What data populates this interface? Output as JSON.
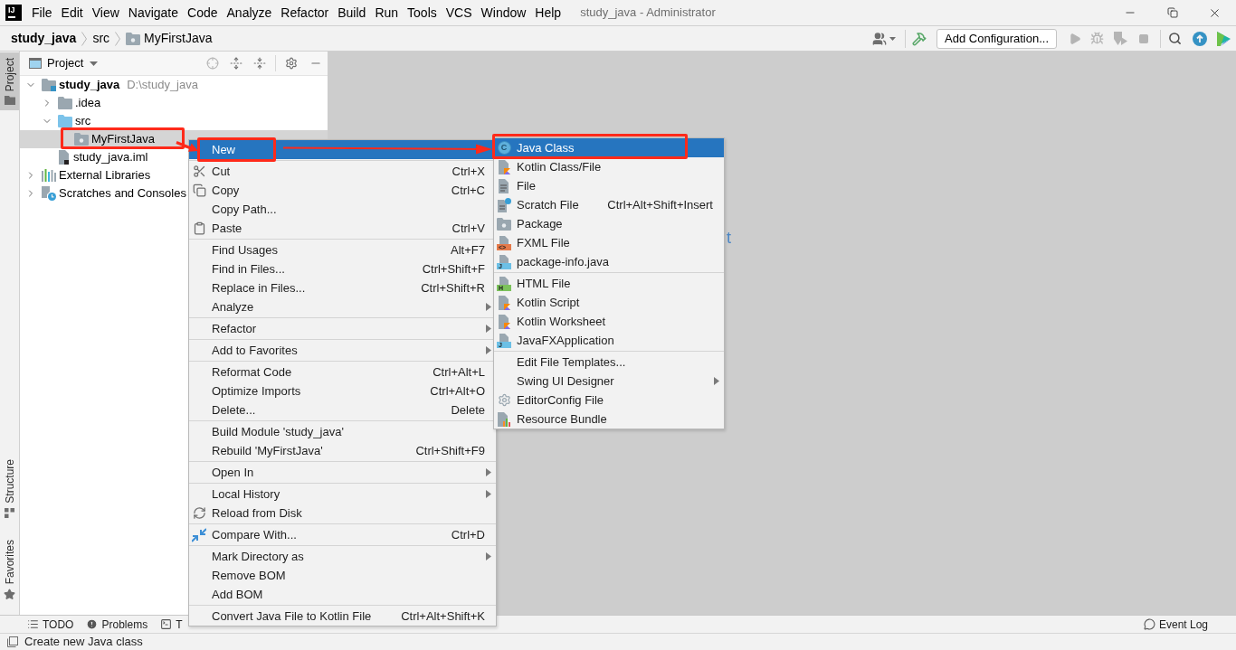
{
  "window": {
    "logo_text": "IJ",
    "title": "study_java - Administrator"
  },
  "menu_bar": [
    "File",
    "Edit",
    "View",
    "Navigate",
    "Code",
    "Analyze",
    "Refactor",
    "Build",
    "Run",
    "Tools",
    "VCS",
    "Window",
    "Help"
  ],
  "breadcrumbs": [
    {
      "label": "study_java",
      "kind": "module"
    },
    {
      "label": "src",
      "kind": "plain"
    },
    {
      "label": "MyFirstJava",
      "kind": "package"
    }
  ],
  "toolbar": {
    "run_configuration": "Add Configuration...",
    "run_disabled": true
  },
  "left_strip": {
    "top": [
      {
        "label": "Project",
        "selected": true
      }
    ],
    "bottom": [
      {
        "label": "Structure",
        "selected": false
      },
      {
        "label": "Favorites",
        "selected": false
      }
    ]
  },
  "project_panel": {
    "title": "Project",
    "tree": [
      {
        "label": "study_java",
        "path": "D:\\study_java",
        "kind": "module",
        "expanded": true,
        "selected": false,
        "annotated": false,
        "children": [
          {
            "label": ".idea",
            "kind": "folder",
            "expanded": false,
            "selected": false,
            "annotated": false
          },
          {
            "label": "src",
            "kind": "source-folder",
            "expanded": true,
            "selected": false,
            "annotated": false,
            "children": [
              {
                "label": "MyFirstJava",
                "kind": "package",
                "selected": true,
                "annotated": true
              }
            ]
          },
          {
            "label": "study_java.iml",
            "kind": "module-file",
            "selected": false,
            "annotated": false
          }
        ]
      },
      {
        "label": "External Libraries",
        "kind": "libraries",
        "expanded": false,
        "selected": false,
        "annotated": false
      },
      {
        "label": "Scratches and Consoles",
        "kind": "scratches",
        "expanded": false,
        "selected": false,
        "annotated": false
      }
    ]
  },
  "editor": {
    "hint": "t"
  },
  "context_menu": {
    "groups": [
      [
        {
          "label": "New",
          "selected": true,
          "submenu": false,
          "annotated": true
        }
      ],
      [
        {
          "label": "Cut",
          "shortcut": "Ctrl+X",
          "selected": false,
          "submenu": false,
          "annotated": false
        },
        {
          "label": "Copy",
          "shortcut": "Ctrl+C",
          "selected": false,
          "submenu": false,
          "annotated": false
        },
        {
          "label": "Copy Path...",
          "selected": false,
          "submenu": false,
          "annotated": false
        },
        {
          "label": "Paste",
          "shortcut": "Ctrl+V",
          "selected": false,
          "submenu": false,
          "annotated": false
        }
      ],
      [
        {
          "label": "Find Usages",
          "shortcut": "Alt+F7",
          "selected": false,
          "submenu": false,
          "annotated": false
        },
        {
          "label": "Find in Files...",
          "shortcut": "Ctrl+Shift+F",
          "selected": false,
          "submenu": false,
          "annotated": false
        },
        {
          "label": "Replace in Files...",
          "shortcut": "Ctrl+Shift+R",
          "selected": false,
          "submenu": false,
          "annotated": false
        },
        {
          "label": "Analyze",
          "selected": false,
          "submenu": true,
          "annotated": false
        }
      ],
      [
        {
          "label": "Refactor",
          "selected": false,
          "submenu": true,
          "annotated": false
        }
      ],
      [
        {
          "label": "Add to Favorites",
          "selected": false,
          "submenu": true,
          "annotated": false
        }
      ],
      [
        {
          "label": "Reformat Code",
          "shortcut": "Ctrl+Alt+L",
          "selected": false,
          "submenu": false,
          "annotated": false
        },
        {
          "label": "Optimize Imports",
          "shortcut": "Ctrl+Alt+O",
          "selected": false,
          "submenu": false,
          "annotated": false
        },
        {
          "label": "Delete...",
          "shortcut": "Delete",
          "selected": false,
          "submenu": false,
          "annotated": false
        }
      ],
      [
        {
          "label": "Build Module 'study_java'",
          "selected": false,
          "submenu": false,
          "annotated": false
        },
        {
          "label": "Rebuild 'MyFirstJava'",
          "shortcut": "Ctrl+Shift+F9",
          "selected": false,
          "submenu": false,
          "annotated": false
        }
      ],
      [
        {
          "label": "Open In",
          "selected": false,
          "submenu": true,
          "annotated": false
        }
      ],
      [
        {
          "label": "Local History",
          "selected": false,
          "submenu": true,
          "annotated": false
        },
        {
          "label": "Reload from Disk",
          "selected": false,
          "submenu": false,
          "annotated": false
        }
      ],
      [
        {
          "label": "Compare With...",
          "shortcut": "Ctrl+D",
          "selected": false,
          "submenu": false,
          "annotated": false
        }
      ],
      [
        {
          "label": "Mark Directory as",
          "selected": false,
          "submenu": true,
          "annotated": false
        },
        {
          "label": "Remove BOM",
          "selected": false,
          "submenu": false,
          "annotated": false
        },
        {
          "label": "Add BOM",
          "selected": false,
          "submenu": false,
          "annotated": false
        }
      ],
      [
        {
          "label": "Convert Java File to Kotlin File",
          "shortcut": "Ctrl+Alt+Shift+K",
          "selected": false,
          "submenu": false,
          "annotated": false
        }
      ]
    ]
  },
  "submenu": {
    "groups": [
      [
        {
          "label": "Java Class",
          "icon_text": "C",
          "selected": true,
          "submenu": false,
          "annotated": true
        },
        {
          "label": "Kotlin Class/File",
          "selected": false,
          "submenu": false,
          "annotated": false
        },
        {
          "label": "File",
          "selected": false,
          "submenu": false,
          "annotated": false
        },
        {
          "label": "Scratch File",
          "shortcut": "Ctrl+Alt+Shift+Insert",
          "selected": false,
          "submenu": false,
          "annotated": false
        },
        {
          "label": "Package",
          "selected": false,
          "submenu": false,
          "annotated": false
        },
        {
          "label": "FXML File",
          "icon_text": "<>",
          "selected": false,
          "submenu": false,
          "annotated": false
        },
        {
          "label": "package-info.java",
          "icon_text": "J",
          "selected": false,
          "submenu": false,
          "annotated": false
        }
      ],
      [
        {
          "label": "HTML File",
          "icon_text": "H",
          "selected": false,
          "submenu": false,
          "annotated": false
        },
        {
          "label": "Kotlin Script",
          "selected": false,
          "submenu": false,
          "annotated": false
        },
        {
          "label": "Kotlin Worksheet",
          "selected": false,
          "submenu": false,
          "annotated": false
        },
        {
          "label": "JavaFXApplication",
          "icon_text": "J",
          "selected": false,
          "submenu": false,
          "annotated": false
        }
      ],
      [
        {
          "label": "Edit File Templates...",
          "selected": false,
          "submenu": false,
          "annotated": false
        },
        {
          "label": "Swing UI Designer",
          "selected": false,
          "submenu": true,
          "annotated": false
        },
        {
          "label": "EditorConfig File",
          "selected": false,
          "submenu": false,
          "annotated": false
        },
        {
          "label": "Resource Bundle",
          "selected": false,
          "submenu": false,
          "annotated": false
        }
      ]
    ]
  },
  "bottom_bar": {
    "tabs": [
      {
        "label": "TODO"
      },
      {
        "label": "Problems"
      },
      {
        "label": "T"
      }
    ],
    "event_log": "Event Log"
  },
  "status_bar": {
    "message": "Create new Java class"
  }
}
